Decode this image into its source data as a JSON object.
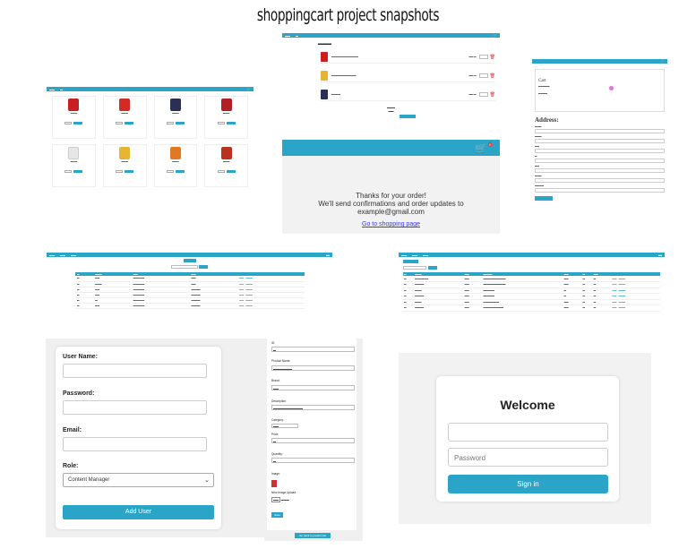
{
  "title": "shoppingcart project snapshots",
  "colors": {
    "accent": "#2aa5c8",
    "delete": "#dd3333",
    "badge": "#ee3333"
  },
  "thanks": {
    "line1": "Thanks for your order!",
    "line2": "We'll send confirmations and order updates to",
    "line3": "example@gmail.com",
    "link": "Go to shopping page",
    "badge": "0"
  },
  "address_form": {
    "cart_title": "Cart",
    "address_heading": "Address:"
  },
  "add_user": {
    "username_label": "User Name:",
    "password_label": "Password:",
    "email_label": "Email:",
    "role_label": "Role:",
    "role_value": "Content Manager",
    "button": "Add User"
  },
  "edit_product": {
    "id_label": "ID:",
    "name_label": "Product Name:",
    "brand_label": "Brand:",
    "description_label": "Description:",
    "category_label": "Category:",
    "price_label": "Price:",
    "quantity_label": "Quantity:",
    "image_label": "Image:",
    "new_image_label": "New Image Upload:",
    "save": "Save",
    "back": "Go back to product list"
  },
  "login": {
    "heading": "Welcome",
    "password_placeholder": "Password",
    "button": "Sign in"
  }
}
